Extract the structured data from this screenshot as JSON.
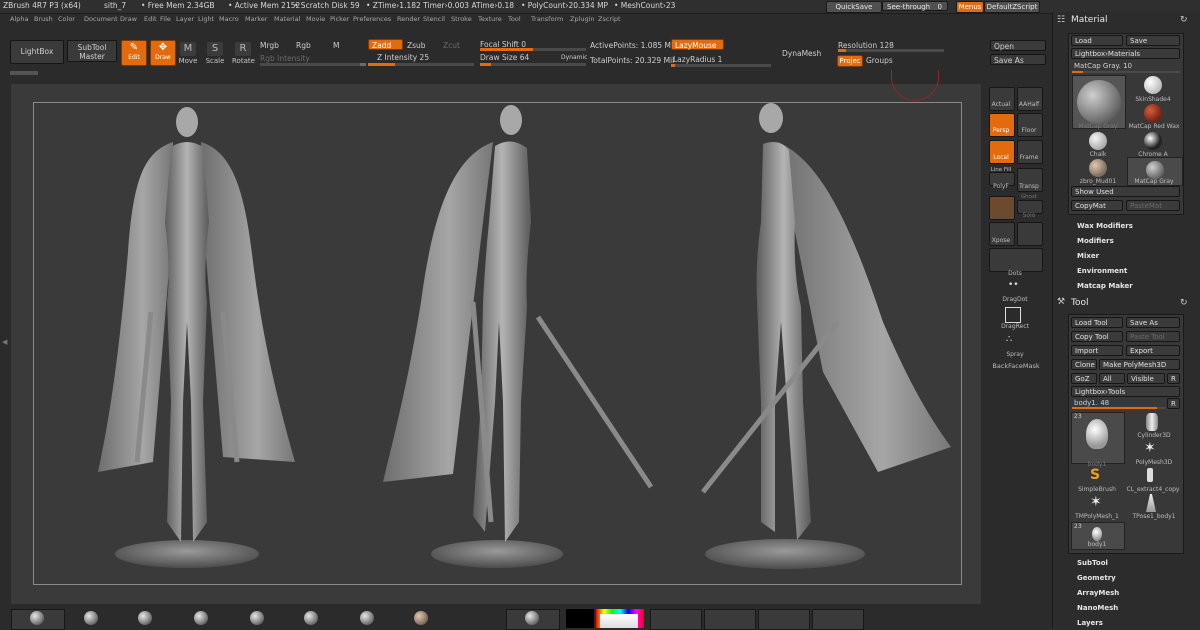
{
  "titlebar": {
    "app": "ZBrush 4R7 P3 (x64)",
    "doc": "sith_7",
    "free_mem": "• Free Mem 2.34GB",
    "active_mem": "• Active Mem 2152",
    "scratch": "• Scratch Disk 59",
    "ztime": "• ZTime›1.182 Timer›0.003 ATime›0.18",
    "polycount": "• PolyCount›20.334 MP",
    "meshcount": "• MeshCount›23",
    "quicksave": "QuickSave",
    "see_through": "See-through",
    "see_through_val": "0",
    "menus": "Menus",
    "default_zscript": "DefaultZScript"
  },
  "menubar": [
    "Alpha",
    "Brush",
    "Color",
    "Document",
    "Draw",
    "Edit",
    "File",
    "Layer",
    "Light",
    "Macro",
    "Marker",
    "Material",
    "Movie",
    "Picker",
    "Preferences",
    "Render",
    "Stencil",
    "Stroke",
    "Texture",
    "Tool",
    "Transform",
    "Zplugin",
    "Zscript"
  ],
  "shelf": {
    "lightbox": "LightBox",
    "subtool_master": "SubTool Master",
    "edit": "Edit",
    "draw": "Draw",
    "move": "Move",
    "scale": "Scale",
    "rotate": "Rotate",
    "mrgb": "Mrgb",
    "rgb": "Rgb",
    "m": "M",
    "rgb_intensity": "Rgb Intensity",
    "zadd": "Zadd",
    "zsub": "Zsub",
    "zcut": "Zcut",
    "z_intensity": "Z Intensity 25",
    "z_intensity_val": 0.25,
    "focal_shift": "Focal Shift 0",
    "focal_shift_val": 0.5,
    "draw_size": "Draw Size 64",
    "draw_size_val": 0.1,
    "dynamic": "Dynamic",
    "active_points": "ActivePoints: 1.085 Mil",
    "total_points": "TotalPoints: 20.329 Mil",
    "lazy_mouse": "LazyMouse",
    "lazy_radius": "LazyRadius 1",
    "dynamesh": "DynaMesh",
    "resolution": "Resolution 128",
    "project": "Projec",
    "groups": "Groups",
    "open": "Open",
    "save_as": "Save As"
  },
  "vstrip": {
    "actual": "Actual",
    "aahalf": "AAHalf",
    "persp": "Persp",
    "floor": "Floor",
    "local": "Local",
    "frame": "Frame",
    "line_fill": "Line Fill",
    "polyf": "PolyF",
    "transp": "Transp",
    "ghost": "Ghost",
    "solo": "Solo",
    "xpose": "Xpose",
    "dots": "Dots",
    "dragdot": "DragDot",
    "dragrect": "DragRect",
    "spray": "Spray",
    "backfacemask": "BackFaceMask"
  },
  "material": {
    "title": "Material",
    "load": "Load",
    "save": "Save",
    "lightbox": "Lightbox›Materials",
    "current": "MatCap Gray. 10",
    "current_val": 0.1,
    "thumbs": [
      "MatCap Gray",
      "SkinShade4",
      "MatCap Red Wax",
      "Chalk",
      "Chrome A",
      "zbro_Mud01",
      "MatCap Gray"
    ],
    "show_used": "Show Used",
    "copymat": "CopyMat",
    "pastemat": "PasteMat",
    "wax_modifiers": "Wax Modifiers",
    "modifiers": "Modifiers",
    "mixer": "Mixer",
    "environment": "Environment",
    "matcap_maker": "Matcap Maker"
  },
  "tool": {
    "title": "Tool",
    "load_tool": "Load Tool",
    "save_as": "Save As",
    "copy_tool": "Copy Tool",
    "paste_tool": "Paste Tool",
    "import": "Import",
    "export": "Export",
    "clone": "Clone",
    "make_polymesh": "Make PolyMesh3D",
    "goz": "GoZ",
    "all": "All",
    "visible": "Visible",
    "r": "R",
    "lightbox_tools": "Lightbox›Tools",
    "current": "body1. 48",
    "current_val": 0.9,
    "count": "23",
    "thumbs": [
      "body1",
      "Cylinder3D",
      "PolyMesh3D",
      "SimpleBrush",
      "CL_extract4_copy",
      "TMPolyMesh_1",
      "TPose1_body1",
      "body1"
    ],
    "count2": "23",
    "subtool": "SubTool",
    "geometry": "Geometry",
    "arraymesh": "ArrayMesh",
    "nanomesh": "NanoMesh",
    "layers": "Layers"
  },
  "colors": {
    "accent": "#e36b0e",
    "bg": "#2b2b2b",
    "viewport": "#3a3a3a"
  }
}
